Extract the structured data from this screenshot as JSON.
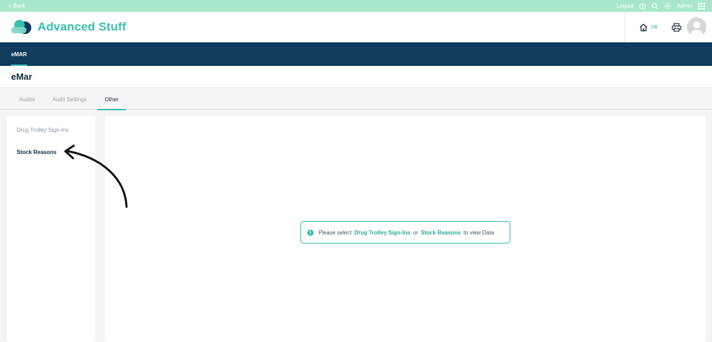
{
  "topbar": {
    "back_label": "< Back",
    "logout_label": "Logout",
    "user_label": "Admin"
  },
  "header": {
    "brand_name": "Advanced Stuff",
    "home_badge": "DB"
  },
  "nav": {
    "items": [
      {
        "label": "eMAR"
      }
    ]
  },
  "page": {
    "title": "eMar"
  },
  "tabs": [
    {
      "label": "Audits"
    },
    {
      "label": "Audit Settings"
    },
    {
      "label": "Other"
    }
  ],
  "sidebar": {
    "items": [
      {
        "label": "Drug Trolley Sign-Ins"
      },
      {
        "label": "Stock Reasons"
      }
    ]
  },
  "notice": {
    "info_glyph": "i",
    "text_before": "Please select",
    "link1": "Drug Trolley Sign-Ins",
    "text_middle": "or",
    "link2": "Stock Reasons",
    "text_after": "to view Data"
  },
  "colors": {
    "accent": "#36bfae",
    "navbar": "#0f3b5c",
    "topbar": "#a8e6cc"
  }
}
